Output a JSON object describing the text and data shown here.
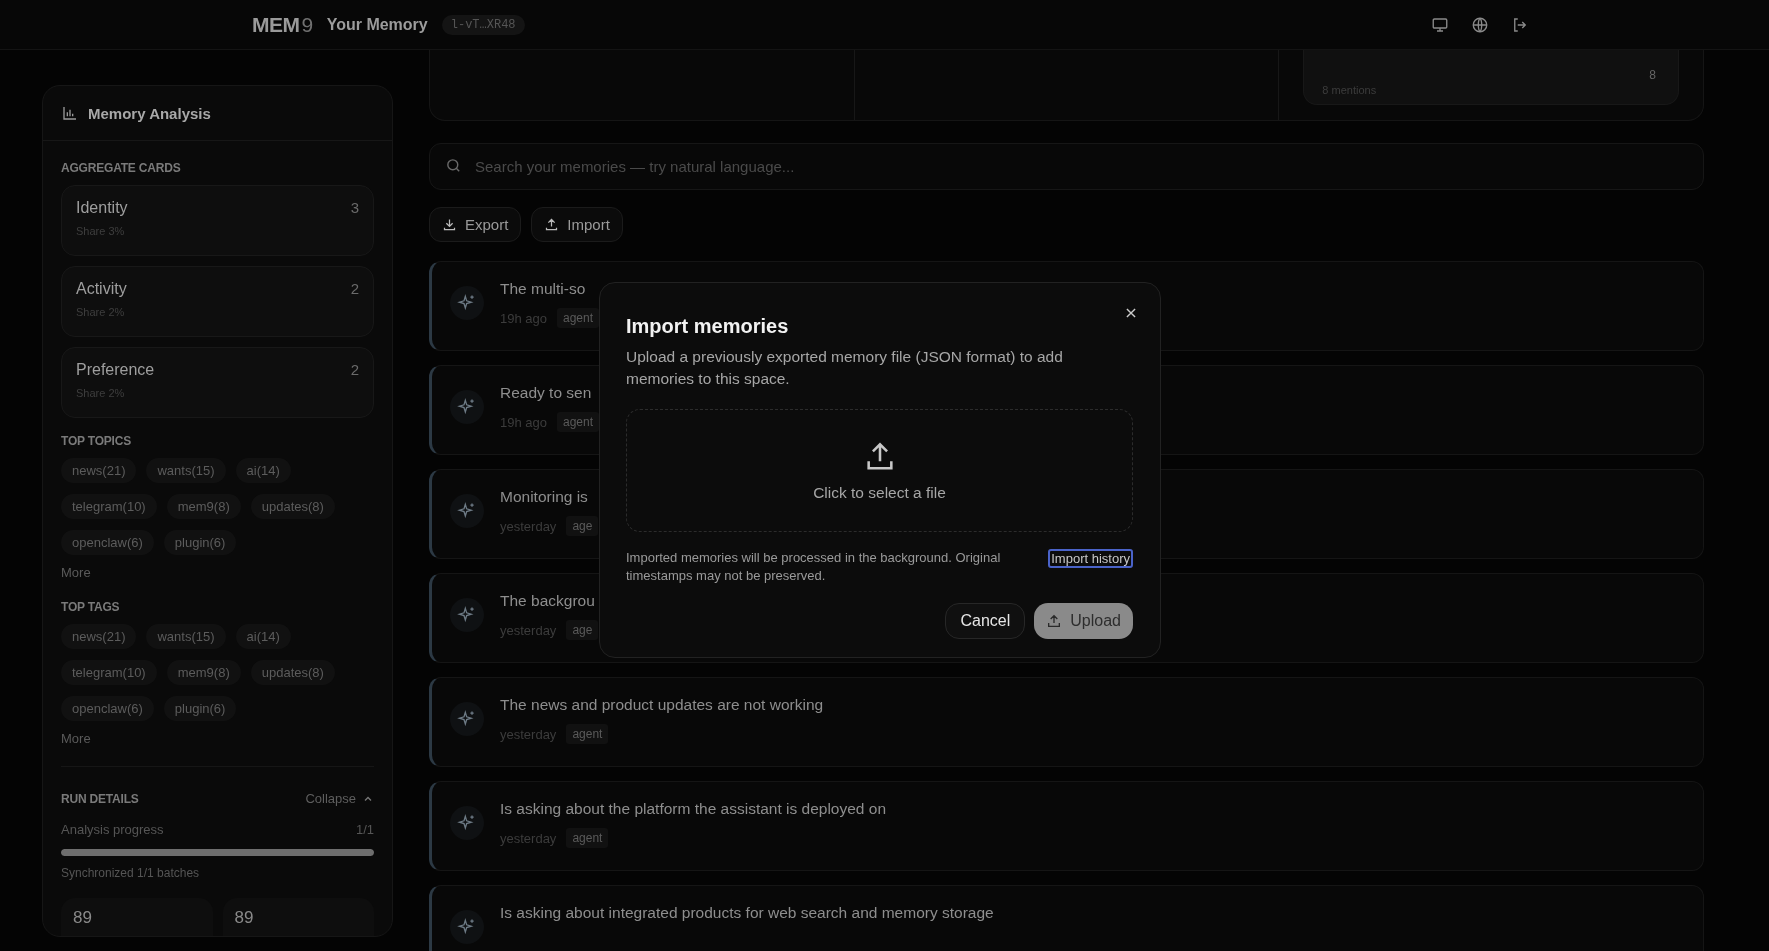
{
  "topbar": {
    "logo": {
      "main": "MEM",
      "suffix": "9"
    },
    "title": "Your Memory",
    "space_id": "l-vT…XR48"
  },
  "top_card": {
    "mentions": "8 mentions",
    "count": "8"
  },
  "sidebar": {
    "title": "Memory Analysis",
    "aggregate_heading": "AGGREGATE CARDS",
    "aggregates": [
      {
        "name": "Identity",
        "share": "Share 3%",
        "count": "3"
      },
      {
        "name": "Activity",
        "share": "Share 2%",
        "count": "2"
      },
      {
        "name": "Preference",
        "share": "Share 2%",
        "count": "2"
      }
    ],
    "topics_heading": "TOP TOPICS",
    "topics": [
      "news(21)",
      "wants(15)",
      "ai(14)",
      "telegram(10)",
      "mem9(8)",
      "updates(8)",
      "openclaw(6)",
      "plugin(6)"
    ],
    "topics_more": "More",
    "tags_heading": "TOP TAGS",
    "tags": [
      "news(21)",
      "wants(15)",
      "ai(14)",
      "telegram(10)",
      "mem9(8)",
      "updates(8)",
      "openclaw(6)",
      "plugin(6)"
    ],
    "tags_more": "More",
    "run_heading": "RUN DETAILS",
    "collapse": "Collapse",
    "progress": {
      "label": "Analysis progress",
      "reading": "1/1",
      "level": 1,
      "note": "Synchronized 1/1 batches"
    },
    "stats": [
      "89",
      "89"
    ]
  },
  "search": {
    "placeholder": "Search your memories — try natural language..."
  },
  "actions": [
    "Export",
    "Import"
  ],
  "memories": [
    {
      "text": "The multi-so",
      "time": "19h ago",
      "tag": "agent"
    },
    {
      "text": "Ready to sen",
      "time": "19h ago",
      "tag": "agent"
    },
    {
      "text": "Monitoring is",
      "time": "yesterday",
      "tag": "age"
    },
    {
      "text": "The backgrou",
      "time": "yesterday",
      "tag": "age"
    },
    {
      "text": "The news and product updates are not working",
      "time": "yesterday",
      "tag": "agent"
    },
    {
      "text": "Is asking about the platform the assistant is deployed on",
      "time": "yesterday",
      "tag": "agent"
    },
    {
      "text": "Is asking about integrated products for web search and memory storage"
    }
  ],
  "dialog": {
    "title": "Import memories",
    "description": "Upload a previously exported memory file (JSON format) to add memories to this space.",
    "dropzone": "Click to select a file",
    "note": "Imported memories will be processed in the background. Original timestamps may not be preserved.",
    "history_link": {
      "label": "Import history",
      "focused": true
    },
    "cancel": "Cancel",
    "upload": "Upload"
  }
}
